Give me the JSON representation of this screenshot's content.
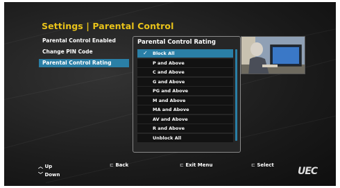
{
  "header": {
    "title": "Settings | Parental Control"
  },
  "menu": {
    "items": [
      {
        "label": "Parental Control Enabled"
      },
      {
        "label": "Change PIN Code"
      },
      {
        "label": "Parental Control Rating"
      }
    ]
  },
  "popup": {
    "title": "Parental Control Rating",
    "options": [
      {
        "label": "Block All"
      },
      {
        "label": "P and Above"
      },
      {
        "label": "C and Above"
      },
      {
        "label": "G and Above"
      },
      {
        "label": "PG and Above"
      },
      {
        "label": "M and Above"
      },
      {
        "label": "MA and Above"
      },
      {
        "label": "AV and Above"
      },
      {
        "label": "R and Above"
      },
      {
        "label": "Unblock All"
      }
    ],
    "check_glyph": "✓"
  },
  "footer": {
    "up": "Up",
    "down": "Down",
    "back": "Back",
    "exit": "Exit Menu",
    "select": "Select"
  },
  "brand": {
    "logo_text": "UEC"
  },
  "colors": {
    "accent": "#2a7fa6",
    "title": "#e8c21a"
  }
}
